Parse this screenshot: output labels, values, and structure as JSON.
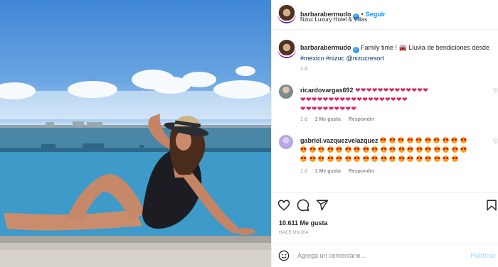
{
  "post": {
    "username": "barbarabermudo",
    "follow_label": "Seguir",
    "separator": "•",
    "location": "Nzuc Luxury Hotel & Villas",
    "caption": {
      "text_before": "Family time ! ",
      "text_mid": " Lluvia de bendiciones desde ",
      "tags": [
        "#mexico",
        "#nizuc",
        "@nizucresort"
      ],
      "time": "1 d"
    }
  },
  "comments": [
    {
      "username": "ricardovargas692",
      "hearts_line1": "❤❤❤❤❤❤❤❤❤❤❤❤❤",
      "hearts_line2": "❤❤❤❤❤❤❤❤❤❤❤❤❤❤❤❤❤❤❤",
      "hearts_line3": "❤❤❤❤❤❤❤❤❤❤",
      "time": "1 d",
      "likes": "2 Me gusta",
      "reply": "Responder"
    },
    {
      "username": "gabriel.vazquezvelazquez",
      "emoji_count_line1": 10,
      "emoji_count_line2": 19,
      "emoji_count_line3": 18,
      "time": "1 d",
      "likes": "1 Me gusta",
      "reply": "Responder"
    }
  ],
  "partial_comment": "...",
  "actions": {
    "likes": "10.611 Me gusta",
    "timestamp": "HACE UN DÍA"
  },
  "add_comment": {
    "placeholder": "Agrega un comentario...",
    "publish_label": "Publicar"
  },
  "icons": [
    "verified-badge-icon",
    "heart-icon",
    "comment-icon",
    "share-icon",
    "bookmark-icon",
    "emoji-icon",
    "car-emoji-icon"
  ],
  "colors": {
    "link": "#0095f6",
    "tag": "#00376b",
    "muted": "#8e8e8e",
    "heart": "#e0245e"
  }
}
